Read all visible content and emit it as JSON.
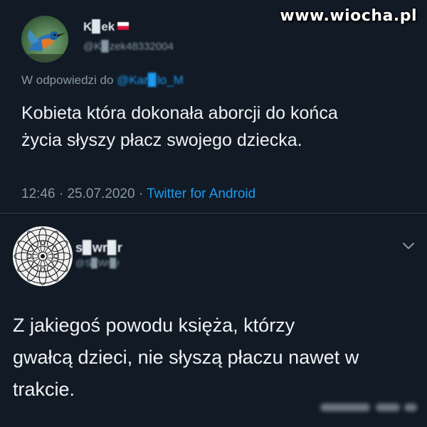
{
  "watermark": "www.wiocha.pl",
  "tweet1": {
    "display_name": "K▉ek",
    "handle": "@K▉zek48332004",
    "reply_prefix": "W odpowiedzi do",
    "reply_mention": "@Kar▉lo_M",
    "text_line1": "Kobieta która dokonała aborcji do końca",
    "text_line2": "życia słyszy płacz swojego dziecka.",
    "time": "12:46",
    "date": "25.07.2020",
    "separator": "·",
    "source": "Twitter for Android",
    "icons": {
      "avatar": "kingfisher-avatar",
      "flag": "poland-flag-icon"
    },
    "flag_colors": [
      "#ffffff",
      "#dc143c"
    ]
  },
  "tweet2": {
    "display_name": "s▉wr▉r",
    "handle": "@S▉Wr▉r",
    "text_line1": "Z jakiegoś powodu księża, którzy",
    "text_line2": "gwałcą dzieci, nie słyszą płaczu nawet w",
    "text_line3": "trakcie.",
    "icons": {
      "avatar": "mandala-avatar",
      "more": "chevron-down-icon"
    }
  },
  "colors": {
    "background": "#111a25",
    "text": "#eef2f5",
    "muted": "#8899a6",
    "link": "#1d9bf0",
    "divider": "#2f3b47"
  }
}
